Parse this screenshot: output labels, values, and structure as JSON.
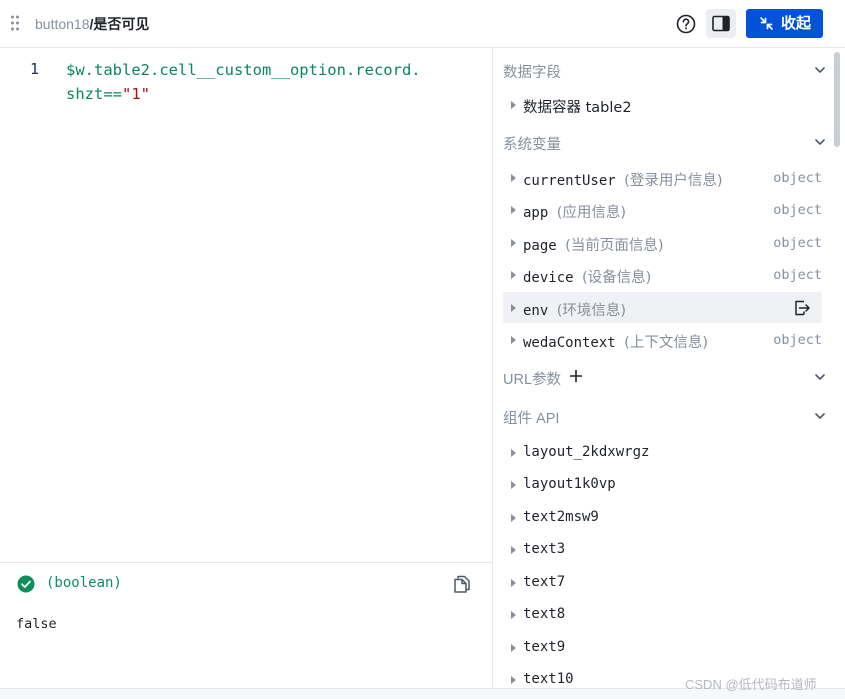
{
  "header": {
    "component_name": "button18",
    "property_title": "/是否可见",
    "collapse_label": "收起"
  },
  "editor": {
    "line_number": "1",
    "code_line1": "$w.table2.cell__custom__option.record.",
    "code_line2_prefix": "shzt==",
    "code_line2_string": "\"1\""
  },
  "result": {
    "type_label": "(boolean)",
    "value": "false"
  },
  "data_fields": {
    "title": "数据字段",
    "items": [
      {
        "name": "数据容器 table2"
      }
    ]
  },
  "system_vars": {
    "title": "系统变量",
    "items": [
      {
        "name": "currentUser",
        "desc": "(登录用户信息)",
        "kind": "object"
      },
      {
        "name": "app",
        "desc": "(应用信息)",
        "kind": "object"
      },
      {
        "name": "page",
        "desc": "(当前页面信息)",
        "kind": "object"
      },
      {
        "name": "device",
        "desc": "(设备信息)",
        "kind": "object"
      },
      {
        "name": "env",
        "desc": "(环境信息)",
        "kind": ""
      },
      {
        "name": "wedaContext",
        "desc": "(上下文信息)",
        "kind": "object"
      }
    ]
  },
  "url_params": {
    "title": "URL参数"
  },
  "component_api": {
    "title": "组件 API",
    "items": [
      {
        "name": "layout_2kdxwrgz"
      },
      {
        "name": "layout1k0vp"
      },
      {
        "name": "text2msw9"
      },
      {
        "name": "text3"
      },
      {
        "name": "text7"
      },
      {
        "name": "text8"
      },
      {
        "name": "text9"
      },
      {
        "name": "text10"
      }
    ]
  },
  "watermark": "CSDN @低代码布道师",
  "colors": {
    "primary": "#0052d9",
    "success": "#0c8f5c",
    "code_green": "#09885a",
    "code_string": "#a31515",
    "muted": "#86909c"
  }
}
